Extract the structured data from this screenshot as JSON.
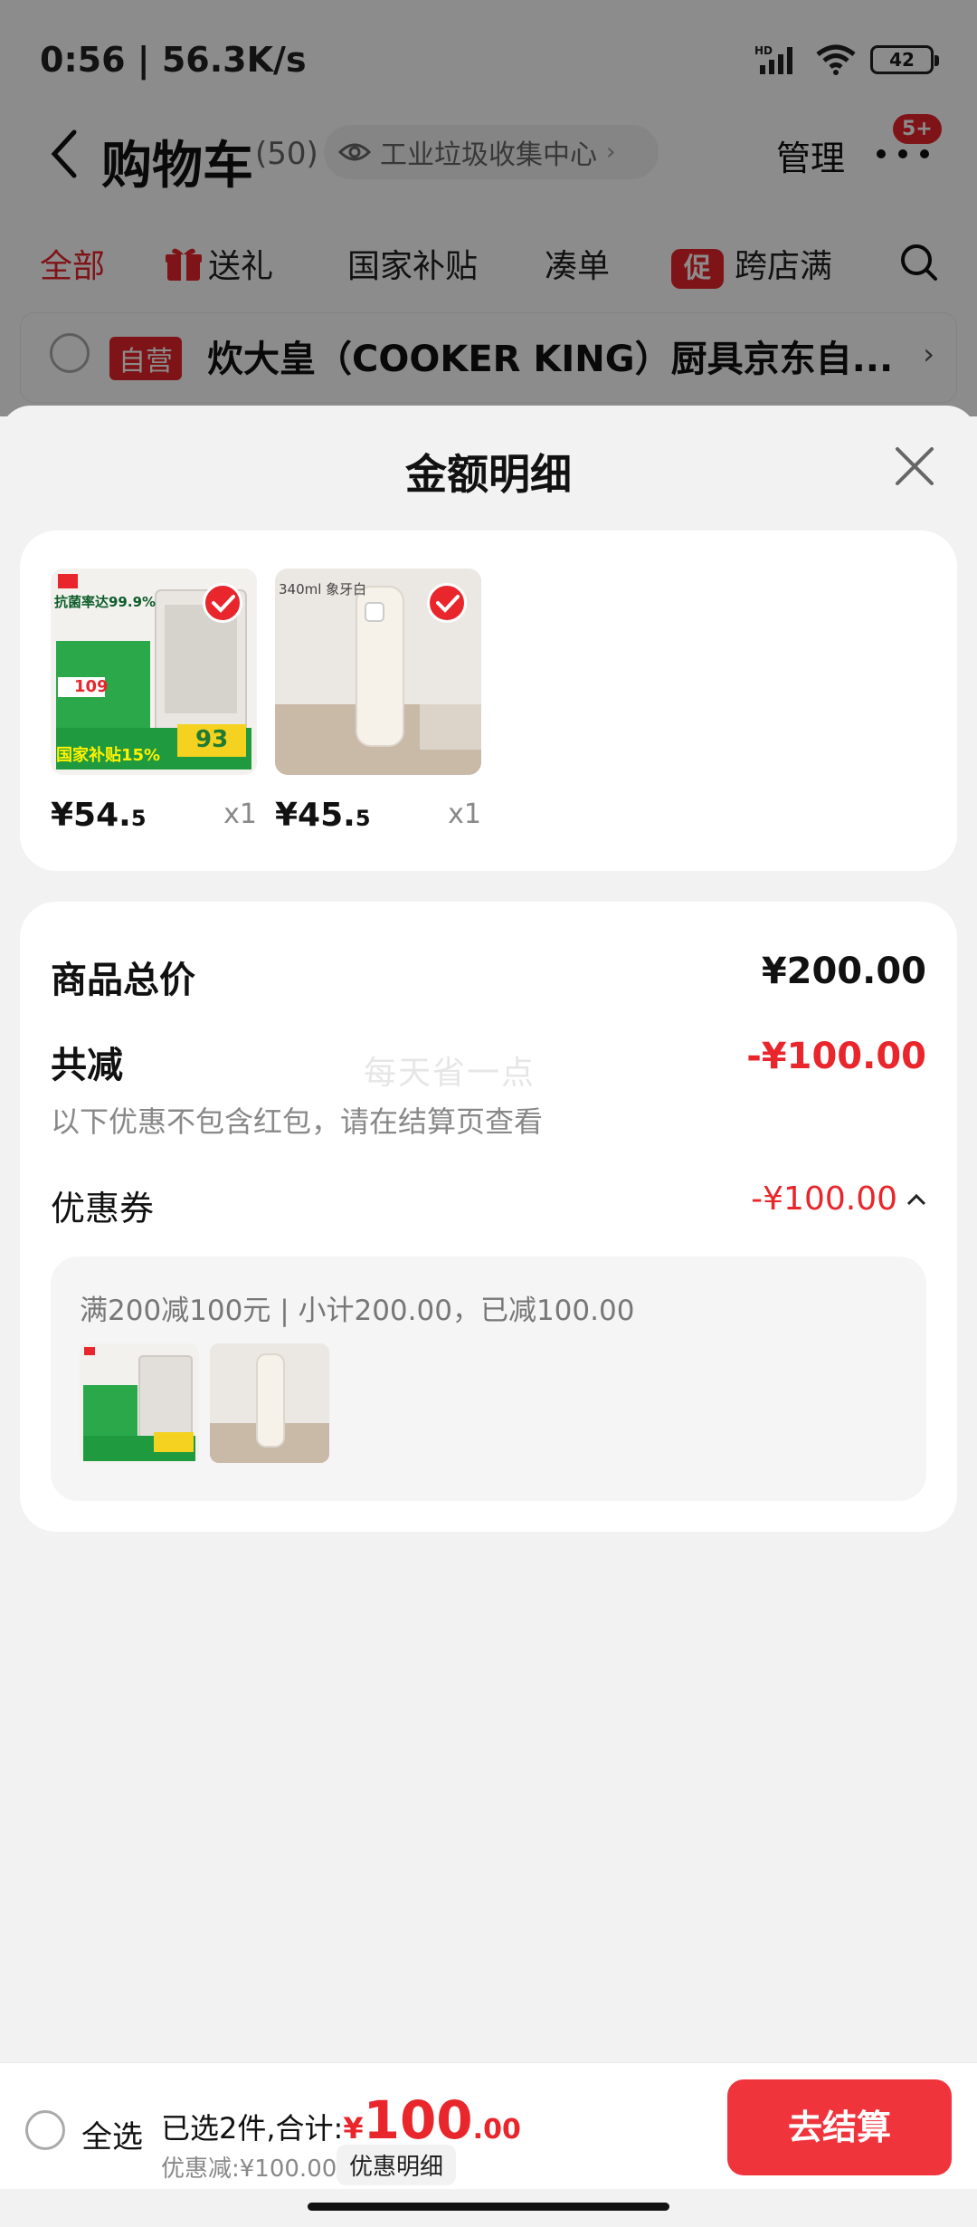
{
  "status_bar": {
    "time": "0:56 | 56.3K/s",
    "battery": "42"
  },
  "nav": {
    "title": "购物车",
    "count": "(50)",
    "location": "工业垃圾收集中心",
    "manage": "管理",
    "message_badge": "5+"
  },
  "filter_tabs": [
    "全部",
    "送礼",
    "国家补贴",
    "凑单",
    "跨店满"
  ],
  "promo_icon_text": "促",
  "store": {
    "badge": "自营",
    "name": "炊大皇（COOKER KING）厨具京东自..."
  },
  "sheet": {
    "title": "金额明细",
    "products": [
      {
        "price_int": "¥54.",
        "price_dec": "5",
        "qty": "x1",
        "thumb_text": "抗菌率达99.9%",
        "thumb_price": "109",
        "thumb_banner": "国家补贴15%",
        "thumb_deal": "93"
      },
      {
        "price_int": "¥45.",
        "price_dec": "5",
        "qty": "x1",
        "thumb_text": "340ml 象牙白"
      }
    ],
    "total_label": "商品总价",
    "total_value": "¥200.00",
    "reduce_label": "共减",
    "reduce_value": "-¥100.00",
    "note": "以下优惠不包含红包，请在结算页查看",
    "watermark": "每天省一点",
    "coupon_label": "优惠券",
    "coupon_value": "-¥100.00",
    "coupon_desc": "满200减100元 | 小计200.00，已减100.00"
  },
  "bottom": {
    "select_all": "全选",
    "selected_text": "已选2件,合计:",
    "yen": "¥",
    "total_int": "100",
    "total_dec": ".00",
    "discount": "优惠减:¥100.00",
    "detail_chip": "优惠明细",
    "checkout": "去结算"
  },
  "colors": {
    "accent": "#e8262c",
    "checkout": "#f0343c"
  }
}
